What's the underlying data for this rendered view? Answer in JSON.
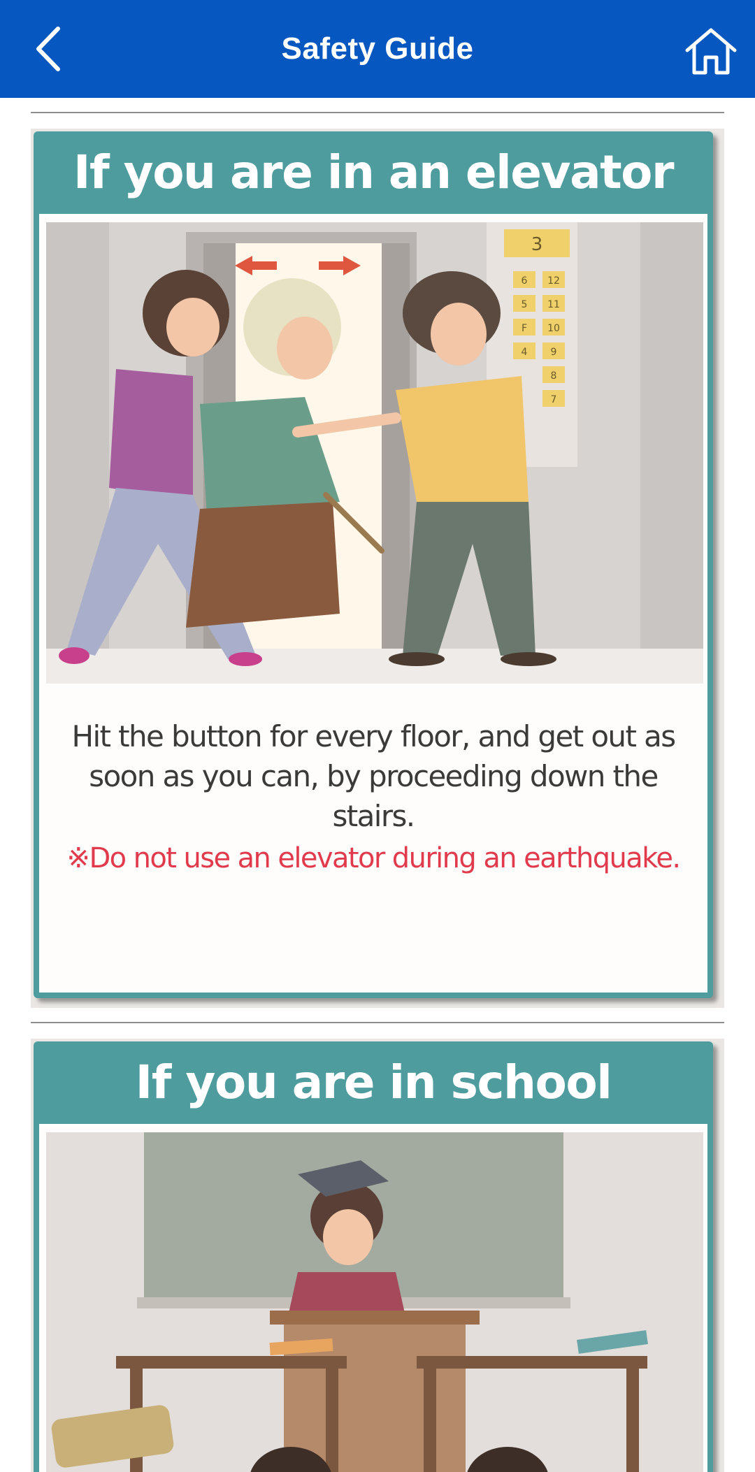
{
  "header": {
    "title": "Safety Guide",
    "back_icon": "chevron-left-icon",
    "home_icon": "home-icon"
  },
  "cards": [
    {
      "heading": "If you are in an elevator",
      "floor_display": "3",
      "elevator_buttons": [
        "6",
        "12",
        "5",
        "11",
        "F",
        "10",
        "4",
        "9",
        "8",
        "7"
      ],
      "description": "Hit the button for every floor, and get out as soon as you can, by proceeding down the stairs.",
      "warning": "※Do not use an elevator during an earthquake."
    },
    {
      "heading": "If you are in school"
    }
  ],
  "colors": {
    "appbar": "#0757c0",
    "card_header": "#4f9c9f",
    "warning_text": "#e03a4c"
  }
}
